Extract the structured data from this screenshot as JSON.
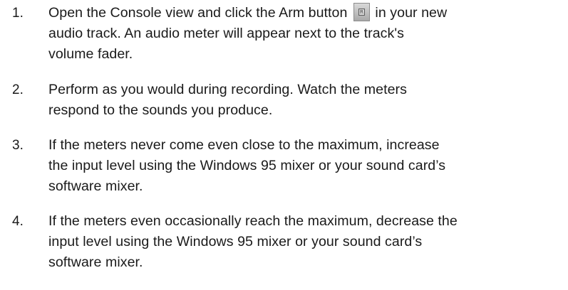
{
  "steps": [
    {
      "number": "1.",
      "lines": [
        "Open the Console view and click the Arm button",
        "in your new",
        "audio track. An audio meter will appear next to the track's",
        "volume fader."
      ],
      "icon": {
        "name": "arm-button-icon",
        "glyph": "R"
      }
    },
    {
      "number": "2.",
      "lines": [
        "Perform as you would during recording. Watch the meters",
        "respond to the sounds you produce."
      ]
    },
    {
      "number": "3.",
      "lines": [
        "If the meters never come even close to the maximum, increase",
        "the input level using the Windows 95 mixer or your sound card’s",
        "software mixer."
      ]
    },
    {
      "number": "4.",
      "lines": [
        "If the meters even occasionally reach the maximum, decrease the",
        "input level using the Windows 95 mixer or your sound card’s",
        "software mixer."
      ]
    }
  ]
}
